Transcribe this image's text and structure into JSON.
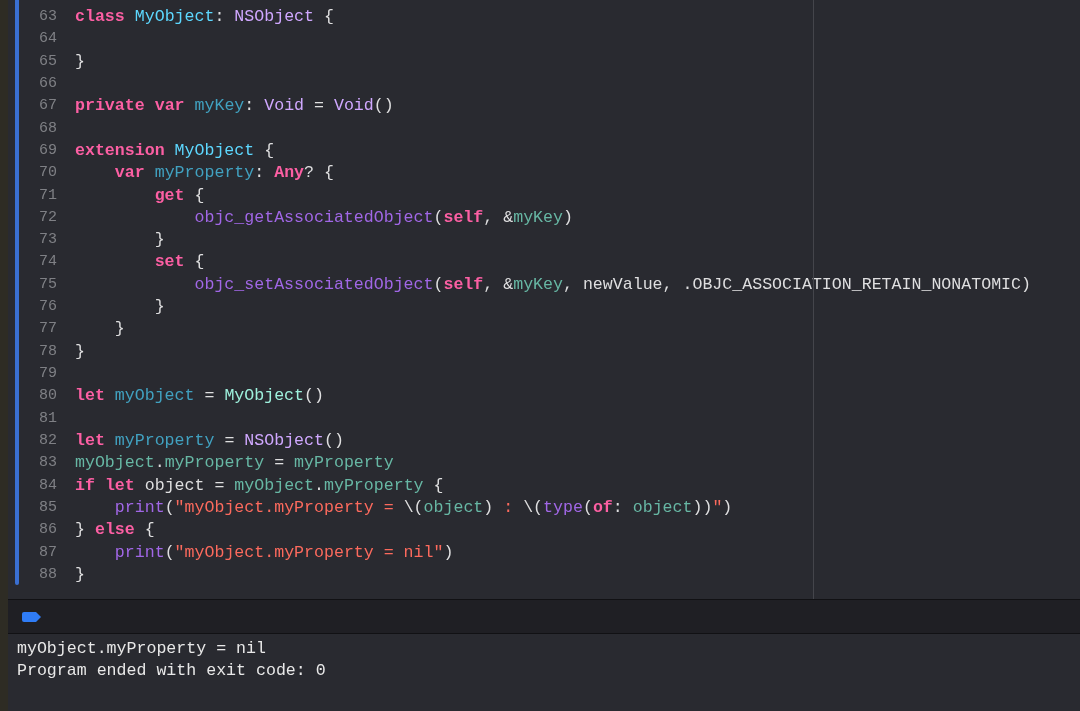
{
  "editor": {
    "lines": [
      {
        "number": "63",
        "tokens": [
          {
            "text": "class",
            "kind": "keyword"
          },
          {
            "text": " MyObject",
            "kind": "decl_type"
          },
          {
            "text": ": ",
            "kind": "plain"
          },
          {
            "text": "NSObject",
            "kind": "type"
          },
          {
            "text": " {",
            "kind": "plain"
          }
        ]
      },
      {
        "number": "64"
      },
      {
        "number": "65",
        "tokens": [
          {
            "text": "}",
            "kind": "plain"
          }
        ]
      },
      {
        "number": "66"
      },
      {
        "number": "67",
        "tokens": [
          {
            "text": "private",
            "kind": "keyword"
          },
          {
            "text": " var",
            "kind": "keyword"
          },
          {
            "text": " myKey",
            "kind": "decl_var"
          },
          {
            "text": ": ",
            "kind": "plain"
          },
          {
            "text": "Void",
            "kind": "type"
          },
          {
            "text": " = ",
            "kind": "plain"
          },
          {
            "text": "Void",
            "kind": "type"
          },
          {
            "text": "()",
            "kind": "plain"
          }
        ]
      },
      {
        "number": "68"
      },
      {
        "number": "69",
        "tokens": [
          {
            "text": "extension",
            "kind": "keyword"
          },
          {
            "text": " MyObject",
            "kind": "decl_type"
          },
          {
            "text": " {",
            "kind": "plain"
          }
        ]
      },
      {
        "number": "70",
        "tokens": [
          {
            "text": "    var",
            "kind": "keyword"
          },
          {
            "text": " myProperty",
            "kind": "decl_var"
          },
          {
            "text": ": ",
            "kind": "plain"
          },
          {
            "text": "Any",
            "kind": "keyword"
          },
          {
            "text": "? {",
            "kind": "plain"
          }
        ]
      },
      {
        "number": "71",
        "tokens": [
          {
            "text": "        get",
            "kind": "keyword"
          },
          {
            "text": " {",
            "kind": "plain"
          }
        ]
      },
      {
        "number": "72",
        "tokens": [
          {
            "text": "            objc_getAssociatedObject",
            "kind": "func"
          },
          {
            "text": "(",
            "kind": "plain"
          },
          {
            "text": "self",
            "kind": "keyword"
          },
          {
            "text": ", &",
            "kind": "plain"
          },
          {
            "text": "myKey",
            "kind": "proj_ref"
          },
          {
            "text": ")",
            "kind": "plain"
          }
        ]
      },
      {
        "number": "73",
        "tokens": [
          {
            "text": "        }",
            "kind": "plain"
          }
        ]
      },
      {
        "number": "74",
        "tokens": [
          {
            "text": "        set",
            "kind": "keyword"
          },
          {
            "text": " {",
            "kind": "plain"
          }
        ]
      },
      {
        "number": "75",
        "tokens": [
          {
            "text": "            objc_setAssociatedObject",
            "kind": "func"
          },
          {
            "text": "(",
            "kind": "plain"
          },
          {
            "text": "self",
            "kind": "keyword"
          },
          {
            "text": ", &",
            "kind": "plain"
          },
          {
            "text": "myKey",
            "kind": "proj_ref"
          },
          {
            "text": ", newValue, .OBJC_ASSOCIATION_RETAIN_NONATOMIC)",
            "kind": "plain"
          }
        ]
      },
      {
        "number": "76",
        "tokens": [
          {
            "text": "        }",
            "kind": "plain"
          }
        ]
      },
      {
        "number": "77",
        "tokens": [
          {
            "text": "    }",
            "kind": "plain"
          }
        ]
      },
      {
        "number": "78",
        "tokens": [
          {
            "text": "}",
            "kind": "plain"
          }
        ]
      },
      {
        "number": "79"
      },
      {
        "number": "80",
        "tokens": [
          {
            "text": "let",
            "kind": "keyword"
          },
          {
            "text": " myObject",
            "kind": "decl_var"
          },
          {
            "text": " = ",
            "kind": "plain"
          },
          {
            "text": "MyObject",
            "kind": "proj_type"
          },
          {
            "text": "()",
            "kind": "plain"
          }
        ]
      },
      {
        "number": "81"
      },
      {
        "number": "82",
        "tokens": [
          {
            "text": "let",
            "kind": "keyword"
          },
          {
            "text": " myProperty",
            "kind": "decl_var"
          },
          {
            "text": " = ",
            "kind": "plain"
          },
          {
            "text": "NSObject",
            "kind": "type"
          },
          {
            "text": "()",
            "kind": "plain"
          }
        ]
      },
      {
        "number": "83",
        "tokens": [
          {
            "text": "myObject",
            "kind": "proj_ref"
          },
          {
            "text": ".",
            "kind": "plain"
          },
          {
            "text": "myProperty",
            "kind": "proj_ref"
          },
          {
            "text": " = ",
            "kind": "plain"
          },
          {
            "text": "myProperty",
            "kind": "proj_ref"
          }
        ]
      },
      {
        "number": "84",
        "tokens": [
          {
            "text": "if",
            "kind": "keyword"
          },
          {
            "text": " let",
            "kind": "keyword"
          },
          {
            "text": " object = ",
            "kind": "plain"
          },
          {
            "text": "myObject",
            "kind": "proj_ref"
          },
          {
            "text": ".",
            "kind": "plain"
          },
          {
            "text": "myProperty",
            "kind": "proj_ref"
          },
          {
            "text": " {",
            "kind": "plain"
          }
        ]
      },
      {
        "number": "85",
        "tokens": [
          {
            "text": "    print",
            "kind": "func"
          },
          {
            "text": "(",
            "kind": "plain"
          },
          {
            "text": "\"myObject.myProperty = ",
            "kind": "string"
          },
          {
            "text": "\\(",
            "kind": "plain"
          },
          {
            "text": "object",
            "kind": "proj_ref"
          },
          {
            "text": ")",
            "kind": "plain"
          },
          {
            "text": " : ",
            "kind": "string"
          },
          {
            "text": "\\(",
            "kind": "plain"
          },
          {
            "text": "type",
            "kind": "func"
          },
          {
            "text": "(",
            "kind": "plain"
          },
          {
            "text": "of",
            "kind": "keyword"
          },
          {
            "text": ": ",
            "kind": "plain"
          },
          {
            "text": "object",
            "kind": "proj_ref"
          },
          {
            "text": "))",
            "kind": "plain"
          },
          {
            "text": "\"",
            "kind": "string"
          },
          {
            "text": ")",
            "kind": "plain"
          }
        ]
      },
      {
        "number": "86",
        "tokens": [
          {
            "text": "} ",
            "kind": "plain"
          },
          {
            "text": "else",
            "kind": "keyword"
          },
          {
            "text": " {",
            "kind": "plain"
          }
        ]
      },
      {
        "number": "87",
        "tokens": [
          {
            "text": "    print",
            "kind": "func"
          },
          {
            "text": "(",
            "kind": "plain"
          },
          {
            "text": "\"myObject.myProperty = nil\"",
            "kind": "string"
          },
          {
            "text": ")",
            "kind": "plain"
          }
        ]
      },
      {
        "number": "88",
        "tokens": [
          {
            "text": "}",
            "kind": "plain"
          }
        ]
      }
    ]
  },
  "console": {
    "lines": [
      "myObject.myProperty = nil",
      "Program ended with exit code: 0"
    ]
  }
}
